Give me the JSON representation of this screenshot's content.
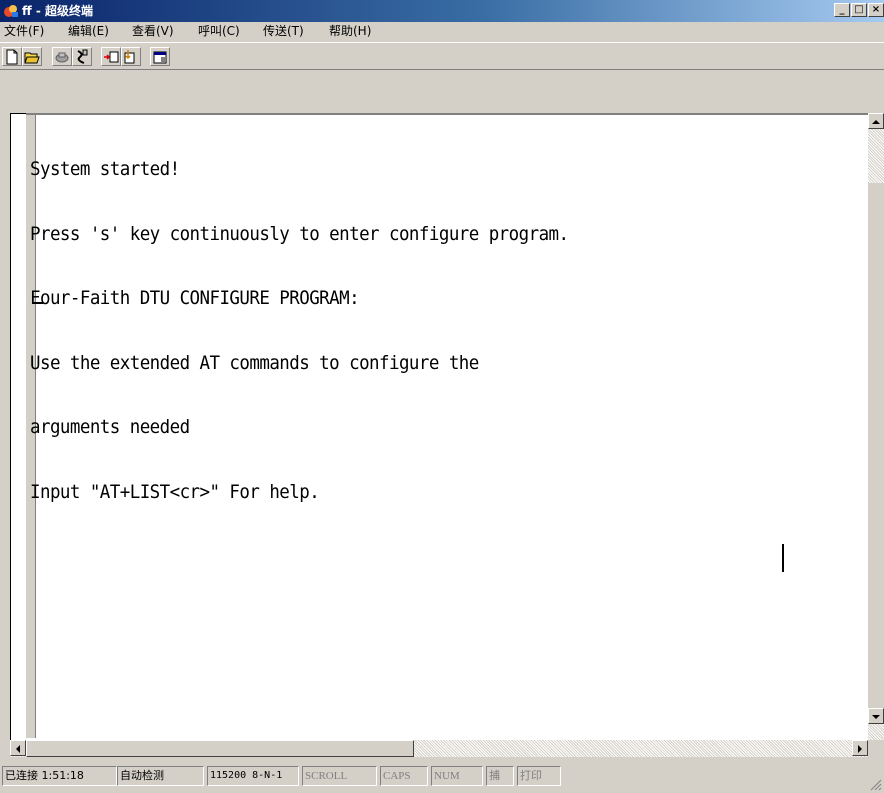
{
  "window": {
    "title": "ff - 超级终端",
    "buttons": {
      "minimize": "_",
      "maximize": "□",
      "close": "×"
    }
  },
  "menu": {
    "items": [
      {
        "label": "文件(F)"
      },
      {
        "label": "编辑(E)"
      },
      {
        "label": "查看(V)"
      },
      {
        "label": "呼叫(C)"
      },
      {
        "label": "传送(T)"
      },
      {
        "label": "帮助(H)"
      }
    ]
  },
  "toolbar": {
    "buttons": [
      {
        "icon": "new-document-icon"
      },
      {
        "icon": "open-folder-icon"
      },
      {
        "icon": "call-icon"
      },
      {
        "icon": "disconnect-icon"
      },
      {
        "icon": "send-icon"
      },
      {
        "icon": "receive-icon"
      },
      {
        "icon": "properties-icon"
      }
    ]
  },
  "terminal": {
    "lines": [
      "System started!",
      "Press 's' key continuously to enter configure program.",
      "Four-Faith DTU CONFIGURE PROGRAM:",
      "Use the extended AT commands to configure the",
      "arguments needed",
      "Input \"AT+LIST<cr>\" For help."
    ]
  },
  "status": {
    "connection": "已连接 1:51:18",
    "detect": "自动检测",
    "port_settings": "115200 8-N-1",
    "scroll": "SCROLL",
    "caps": "CAPS",
    "num": "NUM",
    "capture": "捕",
    "print": "打印"
  },
  "colors": {
    "title_gradient_start": "#0a246a",
    "title_gradient_end": "#a6caf0",
    "chrome": "#d4d0c8",
    "terminal_bg": "#ffffff"
  }
}
